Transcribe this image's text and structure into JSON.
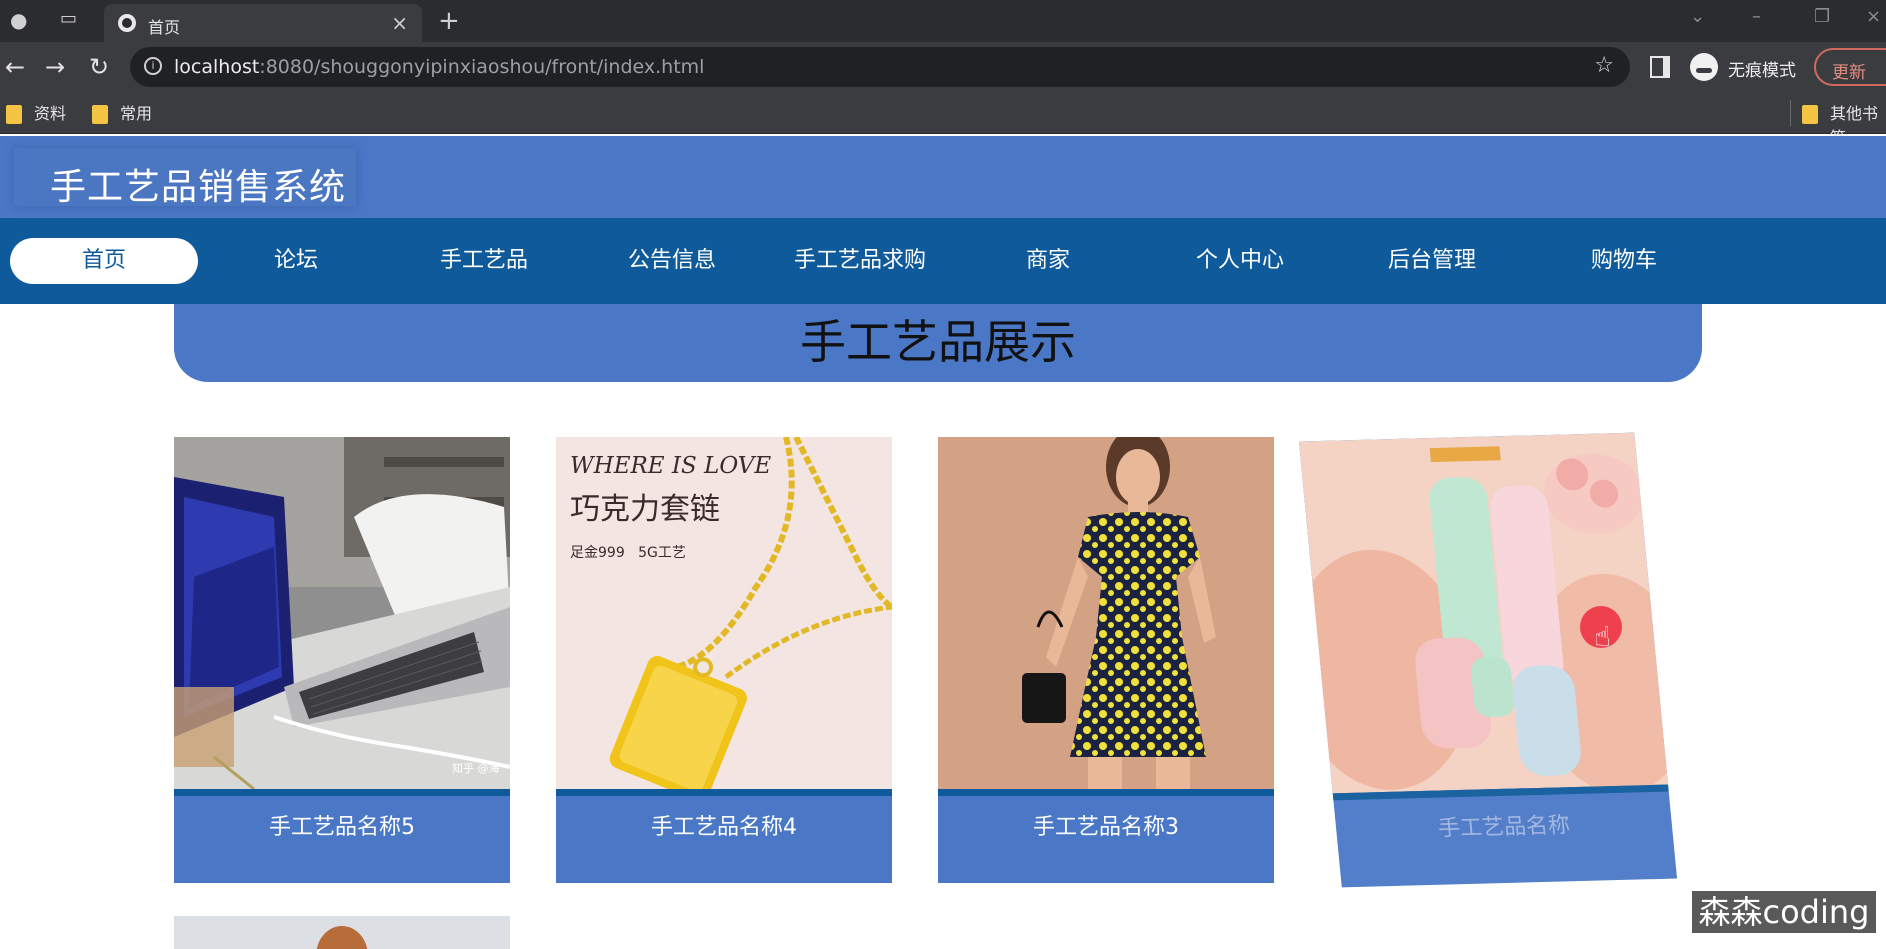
{
  "browser": {
    "tab_title": "首页",
    "url_host": "localhost",
    "url_rest": ":8080/shouggonyipinxiaoshou/front/index.html",
    "incognito_label": "无痕模式",
    "update_label": "更新",
    "bookmarks": [
      "资料",
      "常用"
    ],
    "other_bookmarks": "其他书签"
  },
  "site": {
    "title": "手工艺品销售系统",
    "nav": [
      "首页",
      "论坛",
      "手工艺品",
      "公告信息",
      "手工艺品求购",
      "商家",
      "个人中心",
      "后台管理",
      "购物车"
    ],
    "active_nav": "首页",
    "section_title": "手工艺品展示",
    "products": [
      {
        "name": "手工艺品名称5",
        "image_label": "知乎 @海"
      },
      {
        "name": "手工艺品名称4",
        "image_text_1": "WHERE IS LOVE",
        "image_text_2": "巧克力套链",
        "image_text_3": "足金999   5G工艺"
      },
      {
        "name": "手工艺品名称3"
      },
      {
        "name": "手工艺品名称"
      }
    ]
  },
  "watermark": "森森coding",
  "colors": {
    "header": "#4a78c7",
    "navbar": "#0e5a9b",
    "card": "#4a78c7"
  }
}
